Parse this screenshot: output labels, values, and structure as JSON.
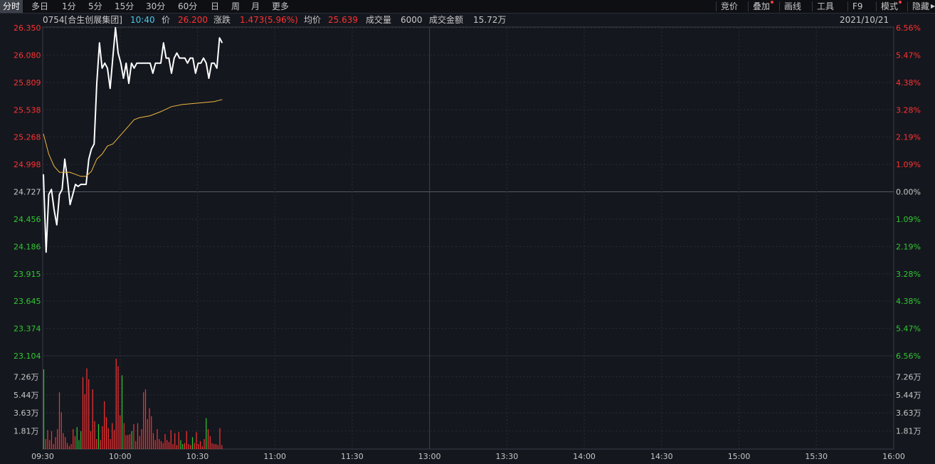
{
  "toolbar": {
    "left": [
      "分时",
      "多日",
      "1分",
      "5分",
      "15分",
      "30分",
      "60分",
      "日",
      "周",
      "月",
      "更多"
    ],
    "right": [
      "竞价",
      "叠加",
      "画线",
      "工具",
      "F9",
      "模式",
      "隐藏"
    ]
  },
  "info": {
    "code_name": "0754[合生创展集团]",
    "time": "10:40",
    "price_label": "价",
    "price": "26.200",
    "change_label": "涨跌",
    "change": "1.473(5.96%)",
    "avg_label": "均价",
    "avg": "25.639",
    "vol_label": "成交量",
    "vol": "6000",
    "amount_label": "成交金额",
    "amount": "15.72万",
    "date": "2021/10/21"
  },
  "colors": {
    "up": "#ff3232",
    "down": "#32c832",
    "price_line": "#ffffff",
    "avg_line": "#f0b840",
    "time": "#4cc8e8",
    "grid": "#2a2e36"
  },
  "chart_data": {
    "type": "line",
    "prev_close": 24.727,
    "price_ticks_left": [
      "26.350",
      "26.080",
      "25.809",
      "25.538",
      "25.268",
      "24.998",
      "24.727",
      "24.456",
      "24.186",
      "23.915",
      "23.645",
      "23.374",
      "23.104"
    ],
    "pct_ticks_right": [
      "6.56%",
      "5.47%",
      "4.38%",
      "3.28%",
      "2.19%",
      "1.09%",
      "0.00%",
      "1.09%",
      "2.19%",
      "3.28%",
      "4.38%",
      "5.47%",
      "6.56%"
    ],
    "ylim": [
      23.104,
      26.35
    ],
    "time_ticks": [
      "09:30",
      "10:00",
      "10:30",
      "11:00",
      "11:30",
      "13:00",
      "13:30",
      "14:00",
      "14:30",
      "15:00",
      "15:30",
      "16:00"
    ],
    "volume_ticks": [
      "7.26万",
      "5.44万",
      "3.63万",
      "1.81万"
    ],
    "volume_ylim": [
      0,
      9.07
    ],
    "price_series": [
      {
        "t": 0,
        "v": 24.9
      },
      {
        "t": 1,
        "v": 24.13
      },
      {
        "t": 2,
        "v": 24.7
      },
      {
        "t": 3,
        "v": 24.75
      },
      {
        "t": 4,
        "v": 24.55
      },
      {
        "t": 5,
        "v": 24.4
      },
      {
        "t": 6,
        "v": 24.7
      },
      {
        "t": 7,
        "v": 24.75
      },
      {
        "t": 8,
        "v": 25.05
      },
      {
        "t": 9,
        "v": 24.85
      },
      {
        "t": 10,
        "v": 24.6
      },
      {
        "t": 11,
        "v": 24.7
      },
      {
        "t": 12,
        "v": 24.8
      },
      {
        "t": 13,
        "v": 24.78
      },
      {
        "t": 14,
        "v": 24.8
      },
      {
        "t": 15,
        "v": 24.8
      },
      {
        "t": 16,
        "v": 24.8
      },
      {
        "t": 17,
        "v": 25.05
      },
      {
        "t": 18,
        "v": 25.15
      },
      {
        "t": 19,
        "v": 25.2
      },
      {
        "t": 20,
        "v": 25.8
      },
      {
        "t": 21,
        "v": 26.2
      },
      {
        "t": 22,
        "v": 25.95
      },
      {
        "t": 23,
        "v": 26.0
      },
      {
        "t": 24,
        "v": 25.95
      },
      {
        "t": 25,
        "v": 25.75
      },
      {
        "t": 26,
        "v": 26.05
      },
      {
        "t": 27,
        "v": 26.35
      },
      {
        "t": 28,
        "v": 26.1
      },
      {
        "t": 29,
        "v": 26.0
      },
      {
        "t": 30,
        "v": 25.85
      },
      {
        "t": 31,
        "v": 26.0
      },
      {
        "t": 32,
        "v": 25.8
      },
      {
        "t": 33,
        "v": 26.0
      },
      {
        "t": 34,
        "v": 25.95
      },
      {
        "t": 35,
        "v": 26.0
      },
      {
        "t": 36,
        "v": 26.0
      },
      {
        "t": 37,
        "v": 26.0
      },
      {
        "t": 38,
        "v": 26.0
      },
      {
        "t": 39,
        "v": 26.0
      },
      {
        "t": 40,
        "v": 26.0
      },
      {
        "t": 41,
        "v": 25.9
      },
      {
        "t": 42,
        "v": 26.0
      },
      {
        "t": 43,
        "v": 26.0
      },
      {
        "t": 44,
        "v": 26.0
      },
      {
        "t": 45,
        "v": 26.2
      },
      {
        "t": 46,
        "v": 26.05
      },
      {
        "t": 47,
        "v": 26.05
      },
      {
        "t": 48,
        "v": 25.9
      },
      {
        "t": 49,
        "v": 26.05
      },
      {
        "t": 50,
        "v": 26.1
      },
      {
        "t": 51,
        "v": 26.05
      },
      {
        "t": 52,
        "v": 26.05
      },
      {
        "t": 53,
        "v": 26.05
      },
      {
        "t": 54,
        "v": 26.0
      },
      {
        "t": 55,
        "v": 26.05
      },
      {
        "t": 56,
        "v": 26.05
      },
      {
        "t": 57,
        "v": 25.9
      },
      {
        "t": 58,
        "v": 26.0
      },
      {
        "t": 59,
        "v": 26.0
      },
      {
        "t": 60,
        "v": 26.05
      },
      {
        "t": 61,
        "v": 26.0
      },
      {
        "t": 62,
        "v": 25.85
      },
      {
        "t": 63,
        "v": 26.0
      },
      {
        "t": 64,
        "v": 26.0
      },
      {
        "t": 65,
        "v": 25.95
      },
      {
        "t": 66,
        "v": 26.25
      },
      {
        "t": 67,
        "v": 26.2
      }
    ],
    "avg_series": [
      {
        "t": 0,
        "v": 25.3
      },
      {
        "t": 2,
        "v": 25.1
      },
      {
        "t": 4,
        "v": 24.98
      },
      {
        "t": 6,
        "v": 24.92
      },
      {
        "t": 10,
        "v": 24.92
      },
      {
        "t": 14,
        "v": 24.88
      },
      {
        "t": 16,
        "v": 24.88
      },
      {
        "t": 18,
        "v": 24.93
      },
      {
        "t": 20,
        "v": 25.05
      },
      {
        "t": 22,
        "v": 25.1
      },
      {
        "t": 24,
        "v": 25.18
      },
      {
        "t": 26,
        "v": 25.2
      },
      {
        "t": 28,
        "v": 25.26
      },
      {
        "t": 30,
        "v": 25.32
      },
      {
        "t": 32,
        "v": 25.38
      },
      {
        "t": 34,
        "v": 25.44
      },
      {
        "t": 36,
        "v": 25.46
      },
      {
        "t": 40,
        "v": 25.48
      },
      {
        "t": 44,
        "v": 25.52
      },
      {
        "t": 48,
        "v": 25.57
      },
      {
        "t": 52,
        "v": 25.59
      },
      {
        "t": 56,
        "v": 25.6
      },
      {
        "t": 60,
        "v": 25.61
      },
      {
        "t": 64,
        "v": 25.62
      },
      {
        "t": 67,
        "v": 25.64
      }
    ],
    "volume_series": [
      {
        "t": 0,
        "v": 8.0,
        "d": "down"
      },
      {
        "t": 1,
        "v": 1.0,
        "d": "up"
      },
      {
        "t": 2,
        "v": 1.9,
        "d": "up"
      },
      {
        "t": 3,
        "v": 0.9,
        "d": "up"
      },
      {
        "t": 4,
        "v": 1.8,
        "d": "up"
      },
      {
        "t": 5,
        "v": 0.5,
        "d": "up"
      },
      {
        "t": 6,
        "v": 1.2,
        "d": "up"
      },
      {
        "t": 7,
        "v": 2.0,
        "d": "up"
      },
      {
        "t": 8,
        "v": 5.7,
        "d": "up"
      },
      {
        "t": 9,
        "v": 3.7,
        "d": "up"
      },
      {
        "t": 10,
        "v": 1.6,
        "d": "up"
      },
      {
        "t": 11,
        "v": 1.2,
        "d": "up"
      },
      {
        "t": 12,
        "v": 0.6,
        "d": "up"
      },
      {
        "t": 13,
        "v": 0.3,
        "d": "up"
      },
      {
        "t": 14,
        "v": 0.5,
        "d": "up"
      },
      {
        "t": 15,
        "v": 2.0,
        "d": "up"
      },
      {
        "t": 16,
        "v": 1.3,
        "d": "up"
      },
      {
        "t": 17,
        "v": 2.2,
        "d": "down"
      },
      {
        "t": 18,
        "v": 0.9,
        "d": "down"
      },
      {
        "t": 19,
        "v": 1.8,
        "d": "down"
      },
      {
        "t": 20,
        "v": 7.2,
        "d": "up"
      },
      {
        "t": 21,
        "v": 5.5,
        "d": "up"
      },
      {
        "t": 22,
        "v": 8.1,
        "d": "up"
      },
      {
        "t": 23,
        "v": 7.0,
        "d": "up"
      },
      {
        "t": 24,
        "v": 1.8,
        "d": "up"
      },
      {
        "t": 25,
        "v": 6.0,
        "d": "up"
      },
      {
        "t": 26,
        "v": 2.8,
        "d": "up"
      },
      {
        "t": 27,
        "v": 1.0,
        "d": "up"
      },
      {
        "t": 28,
        "v": 2.5,
        "d": "down"
      },
      {
        "t": 29,
        "v": 0.9,
        "d": "up"
      },
      {
        "t": 30,
        "v": 2.3,
        "d": "up"
      },
      {
        "t": 31,
        "v": 4.8,
        "d": "up"
      },
      {
        "t": 32,
        "v": 3.2,
        "d": "up"
      },
      {
        "t": 33,
        "v": 2.1,
        "d": "up"
      },
      {
        "t": 34,
        "v": 1.0,
        "d": "up"
      },
      {
        "t": 35,
        "v": 2.6,
        "d": "up"
      },
      {
        "t": 36,
        "v": 1.9,
        "d": "up"
      },
      {
        "t": 37,
        "v": 9.07,
        "d": "up"
      },
      {
        "t": 38,
        "v": 8.3,
        "d": "up"
      },
      {
        "t": 39,
        "v": 3.4,
        "d": "up"
      },
      {
        "t": 40,
        "v": 7.4,
        "d": "down"
      },
      {
        "t": 41,
        "v": 2.6,
        "d": "up"
      },
      {
        "t": 42,
        "v": 1.4,
        "d": "up"
      },
      {
        "t": 43,
        "v": 1.4,
        "d": "up"
      },
      {
        "t": 44,
        "v": 1.5,
        "d": "up"
      },
      {
        "t": 45,
        "v": 1.8,
        "d": "down"
      },
      {
        "t": 46,
        "v": 2.5,
        "d": "up"
      },
      {
        "t": 47,
        "v": 0.8,
        "d": "up"
      },
      {
        "t": 48,
        "v": 2.6,
        "d": "up"
      },
      {
        "t": 49,
        "v": 1.3,
        "d": "up"
      },
      {
        "t": 50,
        "v": 2.0,
        "d": "up"
      },
      {
        "t": 51,
        "v": 5.7,
        "d": "up"
      },
      {
        "t": 52,
        "v": 6.0,
        "d": "up"
      },
      {
        "t": 53,
        "v": 3.0,
        "d": "up"
      },
      {
        "t": 54,
        "v": 4.1,
        "d": "up"
      },
      {
        "t": 55,
        "v": 3.3,
        "d": "up"
      },
      {
        "t": 56,
        "v": 1.6,
        "d": "up"
      },
      {
        "t": 57,
        "v": 0.9,
        "d": "up"
      },
      {
        "t": 58,
        "v": 2.0,
        "d": "up"
      },
      {
        "t": 59,
        "v": 1.0,
        "d": "up"
      },
      {
        "t": 60,
        "v": 0.8,
        "d": "up"
      },
      {
        "t": 61,
        "v": 0.6,
        "d": "up"
      },
      {
        "t": 62,
        "v": 1.5,
        "d": "up"
      },
      {
        "t": 63,
        "v": 0.9,
        "d": "up"
      },
      {
        "t": 64,
        "v": 0.7,
        "d": "up"
      },
      {
        "t": 65,
        "v": 1.9,
        "d": "up"
      },
      {
        "t": 66,
        "v": 0.5,
        "d": "up"
      },
      {
        "t": 67,
        "v": 1.6,
        "d": "up"
      },
      {
        "t": 68,
        "v": 0.4,
        "d": "up"
      },
      {
        "t": 69,
        "v": 1.7,
        "d": "up"
      },
      {
        "t": 70,
        "v": 0.9,
        "d": "down"
      },
      {
        "t": 71,
        "v": 0.5,
        "d": "down"
      },
      {
        "t": 72,
        "v": 0.6,
        "d": "up"
      },
      {
        "t": 73,
        "v": 1.8,
        "d": "up"
      },
      {
        "t": 74,
        "v": 0.5,
        "d": "up"
      },
      {
        "t": 75,
        "v": 0.4,
        "d": "up"
      },
      {
        "t": 76,
        "v": 1.2,
        "d": "down"
      },
      {
        "t": 77,
        "v": 0.6,
        "d": "up"
      },
      {
        "t": 78,
        "v": 1.7,
        "d": "up"
      },
      {
        "t": 79,
        "v": 0.5,
        "d": "up"
      },
      {
        "t": 80,
        "v": 0.8,
        "d": "up"
      },
      {
        "t": 81,
        "v": 0.3,
        "d": "up"
      },
      {
        "t": 82,
        "v": 1.0,
        "d": "up"
      },
      {
        "t": 83,
        "v": 3.1,
        "d": "down"
      },
      {
        "t": 84,
        "v": 2.0,
        "d": "up"
      },
      {
        "t": 85,
        "v": 1.3,
        "d": "up"
      },
      {
        "t": 86,
        "v": 0.6,
        "d": "up"
      },
      {
        "t": 87,
        "v": 0.5,
        "d": "up"
      },
      {
        "t": 88,
        "v": 0.5,
        "d": "up"
      },
      {
        "t": 89,
        "v": 0.4,
        "d": "up"
      },
      {
        "t": 90,
        "v": 2.1,
        "d": "up"
      },
      {
        "t": 91,
        "v": 0.4,
        "d": "up"
      }
    ]
  }
}
